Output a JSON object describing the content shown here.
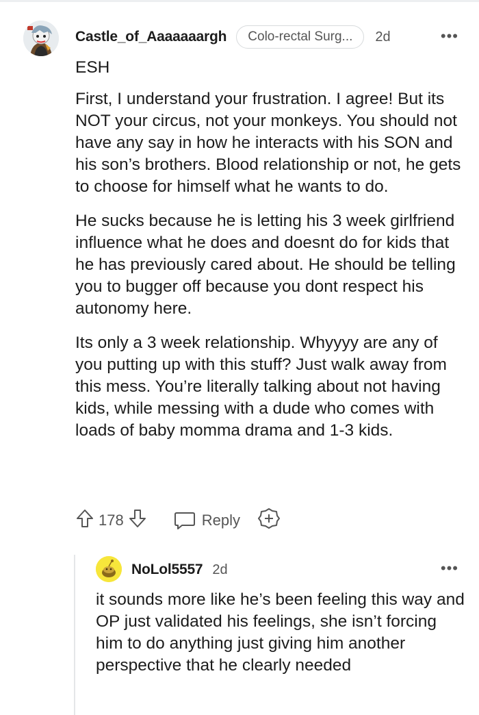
{
  "main_comment": {
    "username": "Castle_of_Aaaaaaargh",
    "flair": "Colo-rectal Surg...",
    "age": "2d",
    "more": "•••",
    "paragraphs": [
      "ESH",
      "First, I understand your frustration. I agree! But its NOT your circus, not your monkeys. You should not have any say in how he interacts with his SON and his son’s brothers. Blood relationship or not, he gets to choose for himself what he wants to do.",
      "He sucks because he is letting his 3 week girlfriend influence what he does and doesnt do for kids that he has previously cared about. He should be telling you to bugger off because you dont respect his autonomy here.",
      "Its only a 3 week relationship. Whyyyy are any of you putting up with this stuff? Just walk away from this mess. You’re literally talking about not having kids, while messing with a dude who comes with loads of baby momma drama and 1-3 kids."
    ],
    "vote_count": "178",
    "reply_label": "Reply"
  },
  "reply_comment": {
    "username": "NoLol5557",
    "age": "2d",
    "more": "•••",
    "text": "it sounds more like he’s been feeling this way and OP just validated his feelings, she isn’t forcing him to do anything just giving him another perspective that he clearly needed"
  },
  "colors": {
    "text": "#1c1c1c",
    "meta": "#555555",
    "reply_avatar_bg": "#f7e63b",
    "thread_line": "#e4e6e8"
  },
  "icons": [
    "upvote-icon",
    "downvote-icon",
    "comment-bubble-icon",
    "award-plus-icon",
    "more-options-icon"
  ]
}
